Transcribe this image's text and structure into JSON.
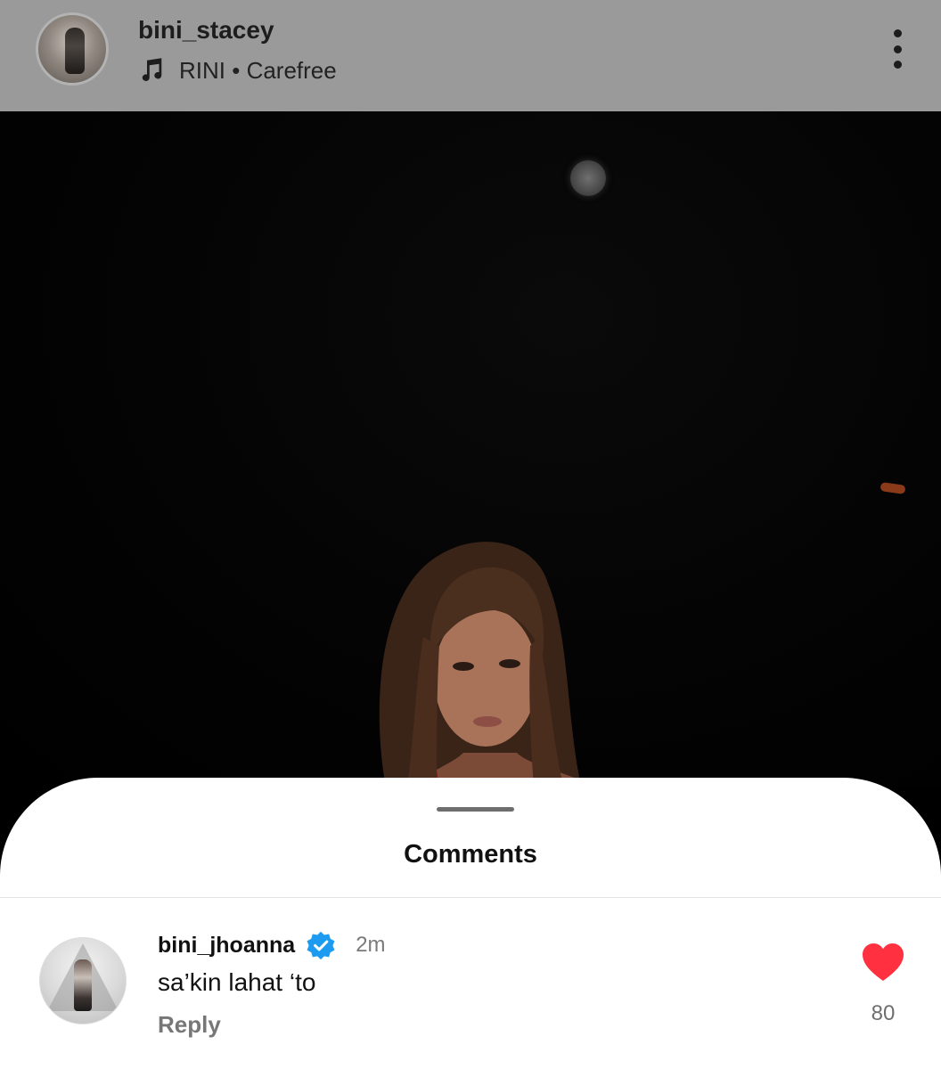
{
  "post": {
    "username": "bini_stacey",
    "music_artist": "RINI",
    "music_track": "Carefree",
    "music_separator": " • ",
    "avatar_icon": "profile-photo",
    "music_icon": "music-note-icon",
    "more_icon": "more-vertical-icon"
  },
  "comments_sheet": {
    "title": "Comments",
    "comments": [
      {
        "username": "bini_jhoanna",
        "verified": true,
        "time": "2m",
        "text": "sa’kin lahat ‘to",
        "reply_label": "Reply",
        "like_count": "80",
        "liked": true
      }
    ]
  },
  "colors": {
    "verified_blue": "#1d9bf0",
    "heart_red": "#ff3040",
    "sheet_bg": "#ffffff",
    "dimmed_header": "#9a9a9a"
  }
}
